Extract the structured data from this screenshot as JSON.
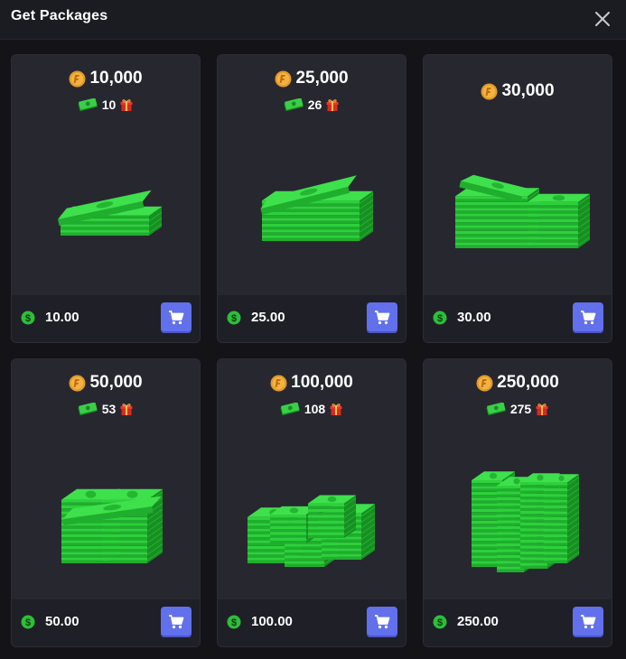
{
  "header": {
    "title": "Get Packages",
    "close_icon": "close-icon"
  },
  "colors": {
    "background": "#131318",
    "card": "#272730",
    "card_footer": "#1f1f27",
    "cart_button": "#6270ec",
    "coin": "#e39a2b",
    "cash": "#2cbf38",
    "gift": "#e8362f"
  },
  "packages": [
    {
      "amount": "10,000",
      "bonus": "10",
      "price": "10.00",
      "art": "small-cash-stack"
    },
    {
      "amount": "25,000",
      "bonus": "26",
      "price": "25.00",
      "art": "medium-cash-stack"
    },
    {
      "amount": "30,000",
      "bonus": "",
      "price": "30.00",
      "art": "double-cash-stack"
    },
    {
      "amount": "50,000",
      "bonus": "53",
      "price": "50.00",
      "art": "large-cash-stack"
    },
    {
      "amount": "100,000",
      "bonus": "108",
      "price": "100.00",
      "art": "cash-pile"
    },
    {
      "amount": "250,000",
      "bonus": "275",
      "price": "250.00",
      "art": "cash-tower"
    }
  ]
}
